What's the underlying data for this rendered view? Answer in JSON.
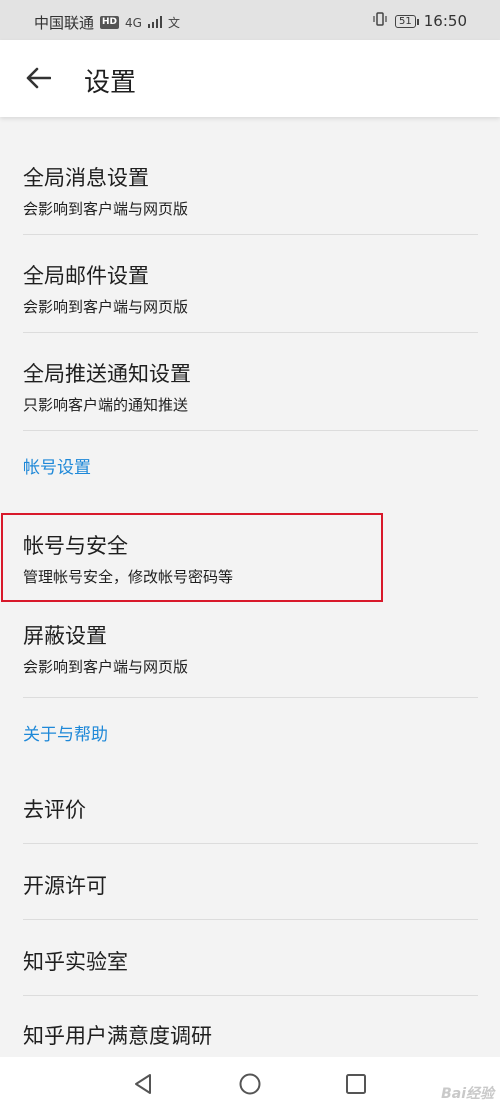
{
  "status_bar": {
    "carrier": "中国联通",
    "hd": "HD",
    "network": "4G",
    "extra": "文",
    "battery": "51",
    "time": "16:50"
  },
  "app_bar": {
    "title": "设置"
  },
  "settings": {
    "items": [
      {
        "title": "全局消息设置",
        "subtitle": "会影响到客户端与网页版"
      },
      {
        "title": "全局邮件设置",
        "subtitle": "会影响到客户端与网页版"
      },
      {
        "title": "全局推送通知设置",
        "subtitle": "只影响客户端的通知推送"
      }
    ],
    "section_account": "帐号设置",
    "account_items": [
      {
        "title": "帐号与安全",
        "subtitle": "管理帐号安全，修改帐号密码等"
      },
      {
        "title": "屏蔽设置",
        "subtitle": "会影响到客户端与网页版"
      }
    ],
    "section_about": "关于与帮助",
    "about_items": [
      {
        "title": "去评价"
      },
      {
        "title": "开源许可"
      },
      {
        "title": "知乎实验室"
      },
      {
        "title": "知乎用户满意度调研"
      }
    ]
  },
  "colors": {
    "accent": "#1e88d8",
    "highlight": "#d8182a",
    "background": "#f3f3f3"
  },
  "watermark": "Bai经验"
}
